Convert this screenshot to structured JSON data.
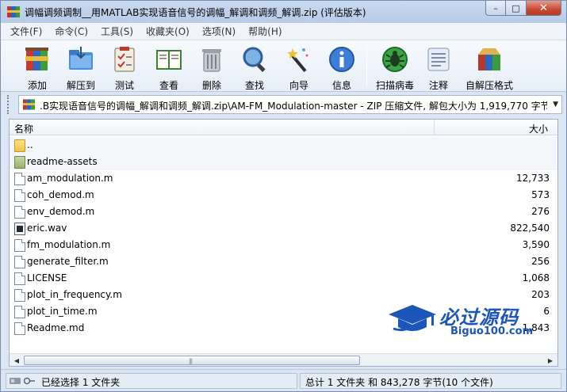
{
  "window": {
    "title": "调幅调频调制__用MATLAB实现语音信号的调幅_解调和调频_解调.zip (评估版本)",
    "controls": {
      "minimize": "–",
      "maximize": "□",
      "close": "✕"
    }
  },
  "menu": [
    "文件(F)",
    "命令(C)",
    "工具(S)",
    "收藏夹(O)",
    "选项(N)",
    "帮助(H)"
  ],
  "toolbar": {
    "add": "添加",
    "extract": "解压到",
    "test": "测试",
    "view": "查看",
    "delete": "删除",
    "find": "查找",
    "wizard": "向导",
    "info": "信息",
    "virus_scan": "扫描病毒",
    "comment": "注释",
    "sfx": "自解压格式"
  },
  "address": {
    "path": ".B实现语音信号的调幅_解调和调频_解调.zip\\AM-FM_Modulation-master - ZIP 压缩文件, 解包大小为 1,919,770 字节"
  },
  "list": {
    "columns": {
      "name": "名称",
      "size": "大小"
    },
    "rows": [
      {
        "name": "..",
        "size": "",
        "icon": "parent-folder-icon"
      },
      {
        "name": "readme-assets",
        "size": "",
        "icon": "folder-icon"
      },
      {
        "name": "am_modulation.m",
        "size": "12,733",
        "icon": "file-icon"
      },
      {
        "name": "coh_demod.m",
        "size": "573",
        "icon": "file-icon"
      },
      {
        "name": "env_demod.m",
        "size": "276",
        "icon": "file-icon"
      },
      {
        "name": "eric.wav",
        "size": "822,540",
        "icon": "audio-file-icon"
      },
      {
        "name": "fm_modulation.m",
        "size": "3,590",
        "icon": "file-icon"
      },
      {
        "name": "generate_filter.m",
        "size": "256",
        "icon": "file-icon"
      },
      {
        "name": "LICENSE",
        "size": "1,068",
        "icon": "file-icon"
      },
      {
        "name": "plot_in_frequency.m",
        "size": "203",
        "icon": "file-icon"
      },
      {
        "name": "plot_in_time.m",
        "size": "6",
        "icon": "file-icon"
      },
      {
        "name": "Readme.md",
        "size": "1,843",
        "icon": "file-icon"
      }
    ]
  },
  "status": {
    "selected": "已经选择 1 文件夹",
    "total": "总计 1 文件夹 和 843,278 字节(10 个文件)"
  },
  "watermark": {
    "cn": "必过源码",
    "en": "Biguo100.com"
  }
}
